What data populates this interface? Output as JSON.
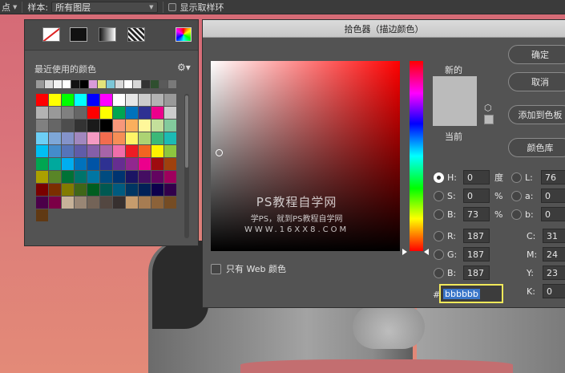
{
  "options_bar": {
    "left_fragment": "点",
    "sample_label": "样本:",
    "sample_value": "所有图层",
    "show_ring_label": "显示取样环"
  },
  "swatches": {
    "recent_label": "最近使用的颜色",
    "recent_colors": [
      "#9a9a9a",
      "#d9d9d9",
      "#f2f2f2",
      "#ffffff",
      "#111111",
      "#000000",
      "#d99bd9",
      "#e3e37a",
      "#7cc6d6",
      "#d8d8d8",
      "#ffffff",
      "#d8d8d8",
      "#333333",
      "#2f4f2f",
      "#5a5a5a",
      "#7a7a7a"
    ],
    "grid_colors": [
      "#ff0000",
      "#ffff00",
      "#00ff00",
      "#00ffff",
      "#0000ff",
      "#ff00ff",
      "#ffffff",
      "#e6e6e6",
      "#cccccc",
      "#b3b3b3",
      "#999999",
      "#b3b3b3",
      "#999999",
      "#808080",
      "#666666",
      "#ff0000",
      "#ffff00",
      "#00a651",
      "#0072bc",
      "#2e3192",
      "#ec008c",
      "#cccccc",
      "#808080",
      "#666666",
      "#4d4d4d",
      "#333333",
      "#1a1a1a",
      "#000000",
      "#f7977a",
      "#fbaf5d",
      "#fff79a",
      "#c4df9b",
      "#82ca9c",
      "#6dcff6",
      "#7ea7d8",
      "#8493ca",
      "#a187be",
      "#f49ac2",
      "#f26c4f",
      "#f68e56",
      "#fff467",
      "#acd373",
      "#3cb878",
      "#1cbbb4",
      "#00bff3",
      "#448ccb",
      "#5674b9",
      "#605ca8",
      "#855fa8",
      "#a864a8",
      "#f06eaa",
      "#ed1c24",
      "#f26522",
      "#fff200",
      "#8dc63f",
      "#00a651",
      "#00a99d",
      "#00aeef",
      "#0072bc",
      "#0054a6",
      "#2e3192",
      "#662d91",
      "#92278f",
      "#ec008c",
      "#9e0b0f",
      "#a0410d",
      "#aba000",
      "#598527",
      "#007236",
      "#00746b",
      "#0076a3",
      "#004b80",
      "#003471",
      "#1b1464",
      "#440e62",
      "#630460",
      "#9e005d",
      "#790000",
      "#7b2e00",
      "#827b00",
      "#406618",
      "#005e20",
      "#005952",
      "#005b7f",
      "#003663",
      "#002157",
      "#0d004c",
      "#32004b",
      "#4b0049",
      "#7b0046",
      "#c7b299",
      "#998675",
      "#736357",
      "#534741",
      "#37302f",
      "#c69c6d",
      "#a67c52",
      "#8c6239",
      "#754c24",
      "#603913"
    ]
  },
  "dialog": {
    "title": "拾色器（描边颜色）",
    "new_label": "新的",
    "current_label": "当前",
    "new_color": "#bbbbbb",
    "current_color": "#bbbbbb",
    "ok_label": "确定",
    "cancel_label": "取消",
    "add_swatch_label": "添加到色板",
    "library_label": "颜色库",
    "web_only_label": "只有 Web 颜色",
    "watermark": {
      "line1": "PS教程自学网",
      "line2": "学PS，就到PS教程自学网",
      "line3": "WWW.16XX8.COM"
    },
    "hsb": [
      {
        "label": "H:",
        "value": "0",
        "unit": "度",
        "selected": true
      },
      {
        "label": "S:",
        "value": "0",
        "unit": "%",
        "selected": false
      },
      {
        "label": "B:",
        "value": "73",
        "unit": "%",
        "selected": false
      }
    ],
    "rgb": [
      {
        "label": "R:",
        "value": "187"
      },
      {
        "label": "G:",
        "value": "187"
      },
      {
        "label": "B:",
        "value": "187"
      }
    ],
    "lab": [
      {
        "label": "L:",
        "value": "76"
      },
      {
        "label": "a:",
        "value": "0"
      },
      {
        "label": "b:",
        "value": "0"
      }
    ],
    "cmyk": [
      {
        "label": "C:",
        "value": "31"
      },
      {
        "label": "M:",
        "value": "24"
      },
      {
        "label": "Y:",
        "value": "23"
      },
      {
        "label": "K:",
        "value": "0"
      }
    ],
    "hex_label": "#",
    "hex_value": "bbbbbb"
  }
}
